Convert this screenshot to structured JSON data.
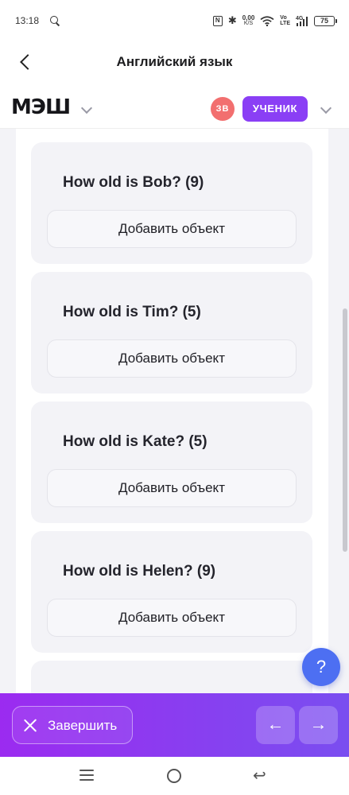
{
  "status_bar": {
    "time": "13:18",
    "net_speed_value": "0,00",
    "net_speed_unit": "K/S",
    "volte_top": "Vo",
    "volte_bottom": "LTE",
    "network": "4G",
    "battery": "75",
    "nfc_label": "N"
  },
  "header": {
    "title": "Английский язык"
  },
  "mesh": {
    "logo": "МЭШ",
    "avatar_initials": "ЗВ",
    "role": "УЧЕНИК",
    "avatar_color": "#f26f6f",
    "role_color": "#8a3ff5"
  },
  "cards": [
    {
      "question": "How old is Bob? (9)",
      "button": "Добавить объект"
    },
    {
      "question": "How old is Tim? (5)",
      "button": "Добавить объект"
    },
    {
      "question": "How old is Kate? (5)",
      "button": "Добавить объект"
    },
    {
      "question": "How old is Helen? (9)",
      "button": "Добавить объект"
    }
  ],
  "help": {
    "label": "?"
  },
  "footer": {
    "finish_label": "Завершить",
    "prev_arrow": "←",
    "next_arrow": "→",
    "gradient_start": "#9b2bf0",
    "gradient_end": "#7a4ef0"
  },
  "system_nav": {
    "back_glyph": "↩"
  }
}
